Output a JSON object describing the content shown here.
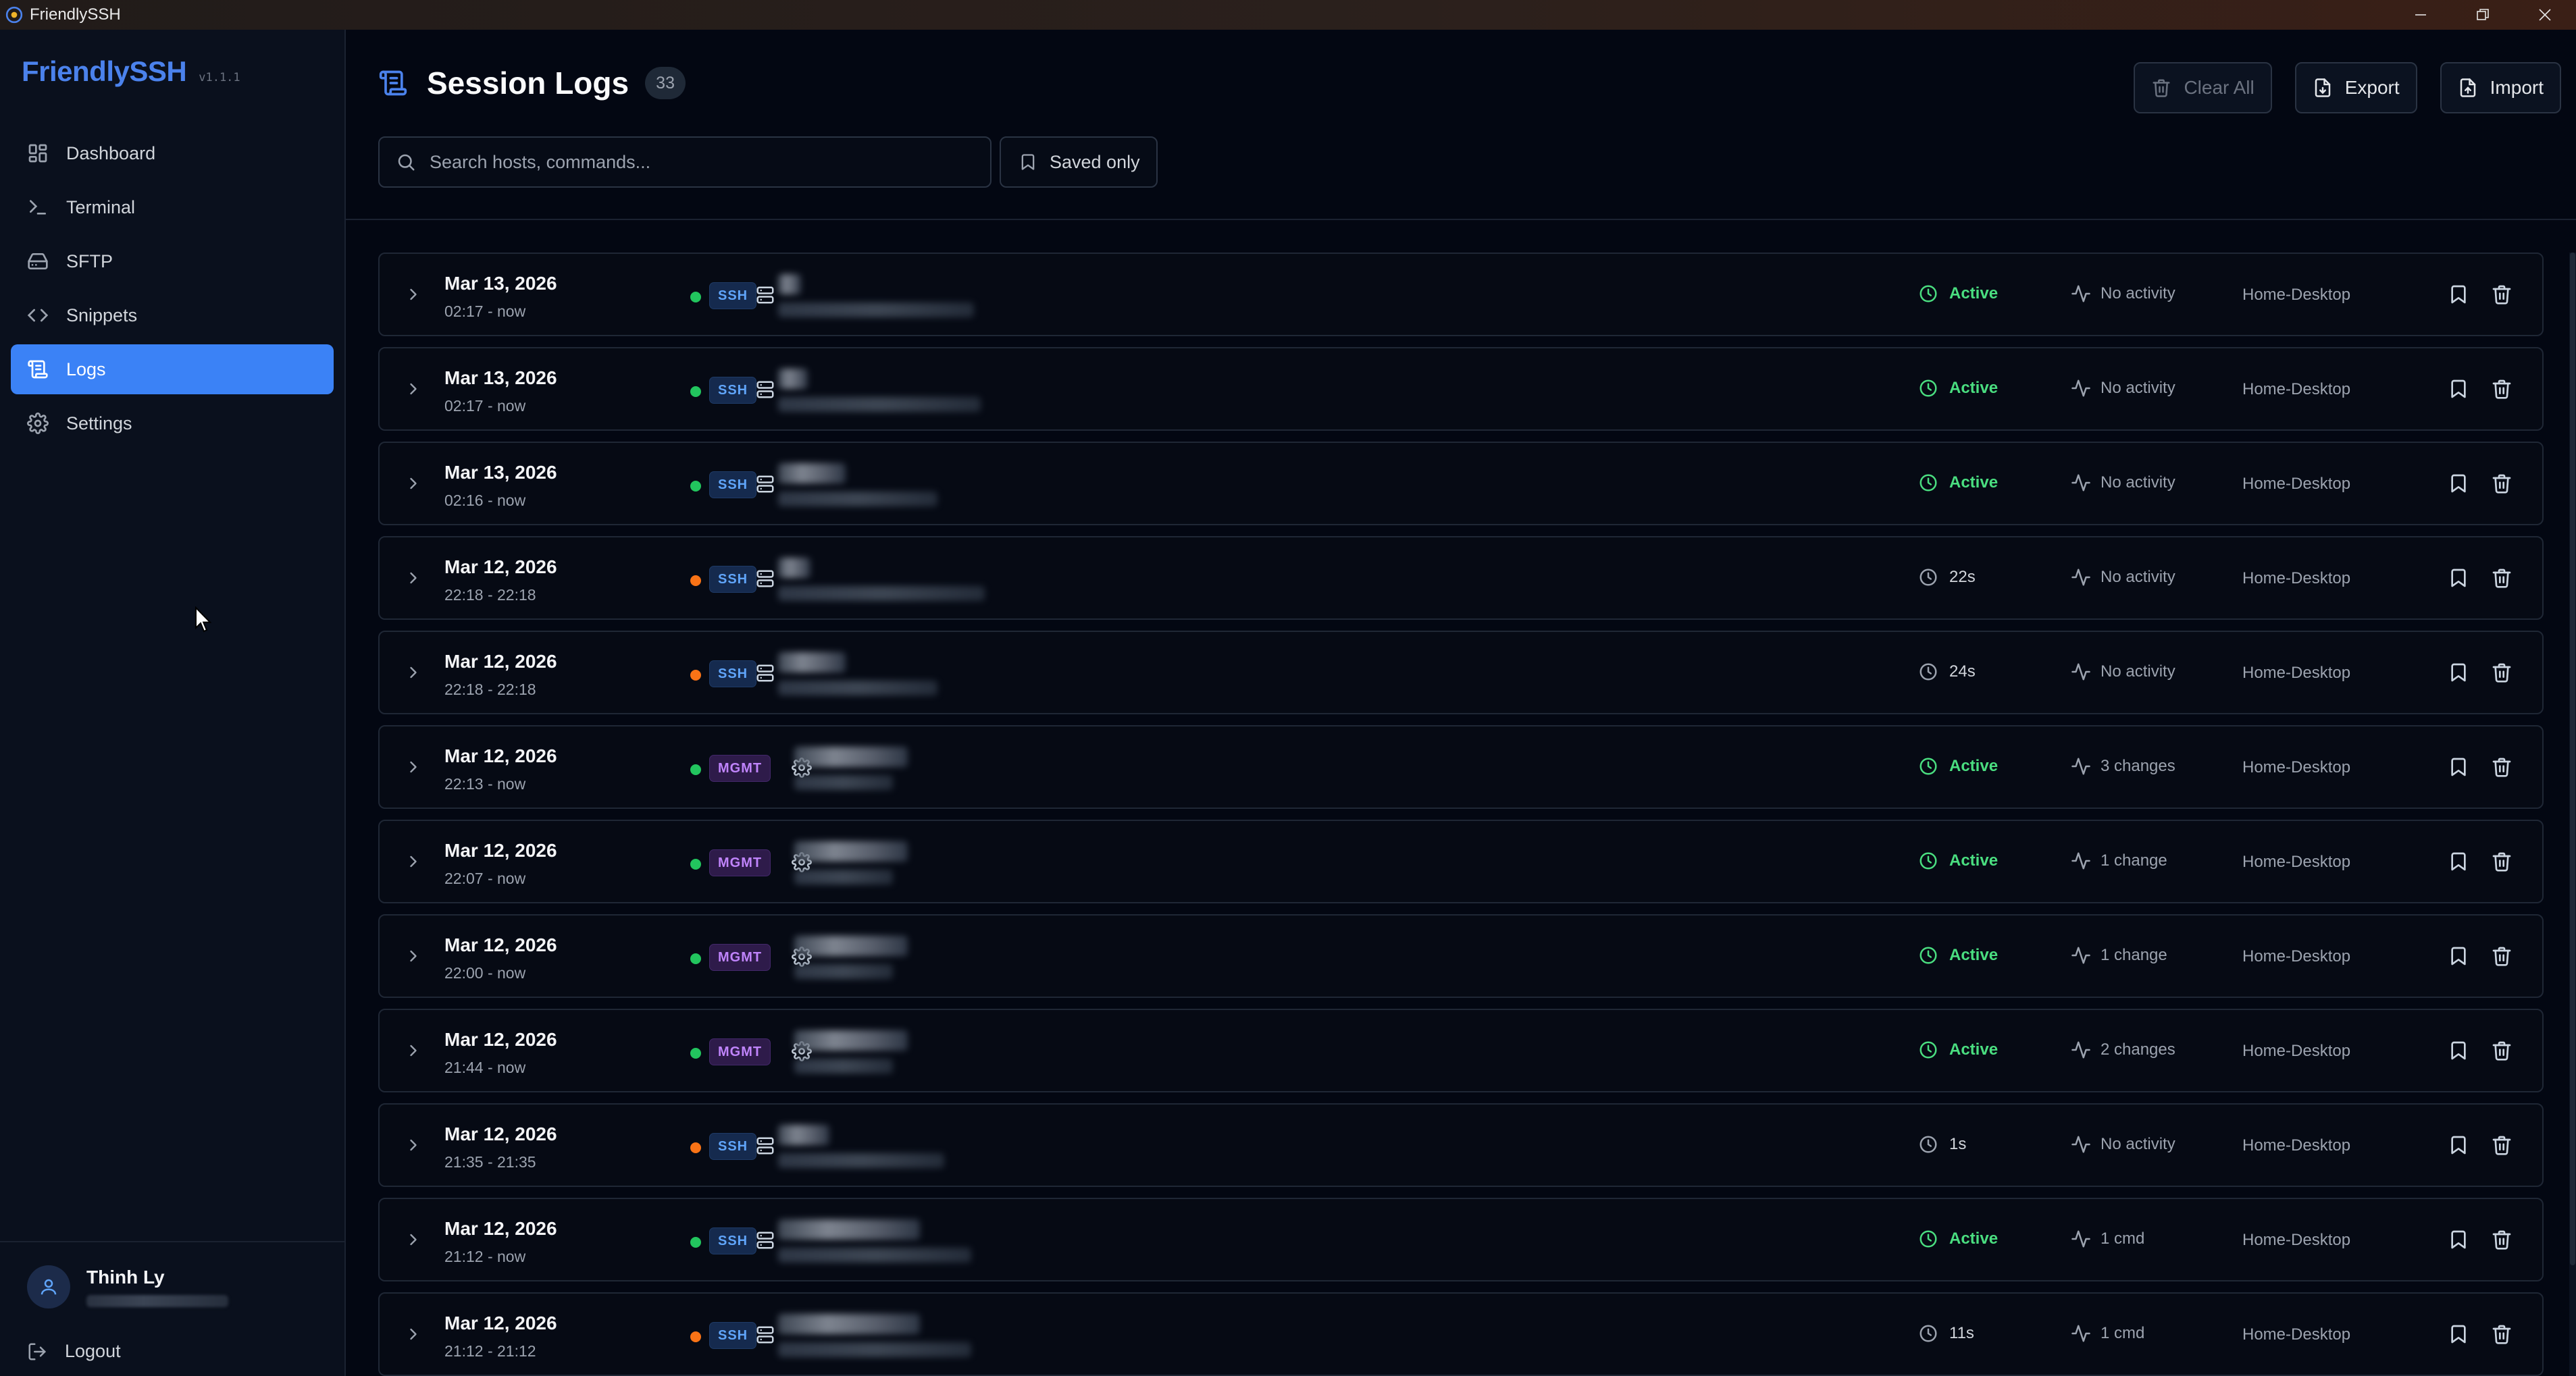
{
  "window": {
    "title": "FriendlySSH"
  },
  "brand": {
    "name": "FriendlySSH",
    "version": "v1.1.1"
  },
  "nav": [
    {
      "label": "Dashboard",
      "icon": "dashboard-icon",
      "active": false
    },
    {
      "label": "Terminal",
      "icon": "terminal-icon",
      "active": false
    },
    {
      "label": "SFTP",
      "icon": "drive-icon",
      "active": false
    },
    {
      "label": "Snippets",
      "icon": "code-icon",
      "active": false
    },
    {
      "label": "Logs",
      "icon": "logs-icon",
      "active": true
    },
    {
      "label": "Settings",
      "icon": "gear-icon",
      "active": false
    }
  ],
  "user": {
    "name": "Thinh Ly",
    "logout_label": "Logout"
  },
  "page": {
    "title": "Session Logs",
    "count": "33",
    "clear_all_label": "Clear All",
    "export_label": "Export",
    "import_label": "Import",
    "search_placeholder": "Search hosts, commands...",
    "saved_only_label": "Saved only"
  },
  "colors": {
    "accent": "#3b82f6",
    "active_status": "#4ade80",
    "ended_dot": "#f97316",
    "ssh_badge": "#60a5fa",
    "mgmt_badge": "#c084fc"
  },
  "sessions": [
    {
      "date": "Mar 13, 2026",
      "time": "02:17 - now",
      "type": "SSH",
      "dot": "active",
      "status": "Active",
      "activity": "No activity",
      "machine": "Home-Desktop"
    },
    {
      "date": "Mar 13, 2026",
      "time": "02:17 - now",
      "type": "SSH",
      "dot": "active",
      "status": "Active",
      "activity": "No activity",
      "machine": "Home-Desktop"
    },
    {
      "date": "Mar 13, 2026",
      "time": "02:16 - now",
      "type": "SSH",
      "dot": "active",
      "status": "Active",
      "activity": "No activity",
      "machine": "Home-Desktop"
    },
    {
      "date": "Mar 12, 2026",
      "time": "22:18 - 22:18",
      "type": "SSH",
      "dot": "ended",
      "status": "22s",
      "activity": "No activity",
      "machine": "Home-Desktop"
    },
    {
      "date": "Mar 12, 2026",
      "time": "22:18 - 22:18",
      "type": "SSH",
      "dot": "ended",
      "status": "24s",
      "activity": "No activity",
      "machine": "Home-Desktop"
    },
    {
      "date": "Mar 12, 2026",
      "time": "22:13 - now",
      "type": "MGMT",
      "dot": "active",
      "status": "Active",
      "activity": "3 changes",
      "machine": "Home-Desktop"
    },
    {
      "date": "Mar 12, 2026",
      "time": "22:07 - now",
      "type": "MGMT",
      "dot": "active",
      "status": "Active",
      "activity": "1 change",
      "machine": "Home-Desktop"
    },
    {
      "date": "Mar 12, 2026",
      "time": "22:00 - now",
      "type": "MGMT",
      "dot": "active",
      "status": "Active",
      "activity": "1 change",
      "machine": "Home-Desktop"
    },
    {
      "date": "Mar 12, 2026",
      "time": "21:44 - now",
      "type": "MGMT",
      "dot": "active",
      "status": "Active",
      "activity": "2 changes",
      "machine": "Home-Desktop"
    },
    {
      "date": "Mar 12, 2026",
      "time": "21:35 - 21:35",
      "type": "SSH",
      "dot": "ended",
      "status": "1s",
      "activity": "No activity",
      "machine": "Home-Desktop"
    },
    {
      "date": "Mar 12, 2026",
      "time": "21:12 - now",
      "type": "SSH",
      "dot": "active",
      "status": "Active",
      "activity": "1 cmd",
      "machine": "Home-Desktop"
    },
    {
      "date": "Mar 12, 2026",
      "time": "21:12 - 21:12",
      "type": "SSH",
      "dot": "ended",
      "status": "11s",
      "activity": "1 cmd",
      "machine": "Home-Desktop"
    }
  ]
}
